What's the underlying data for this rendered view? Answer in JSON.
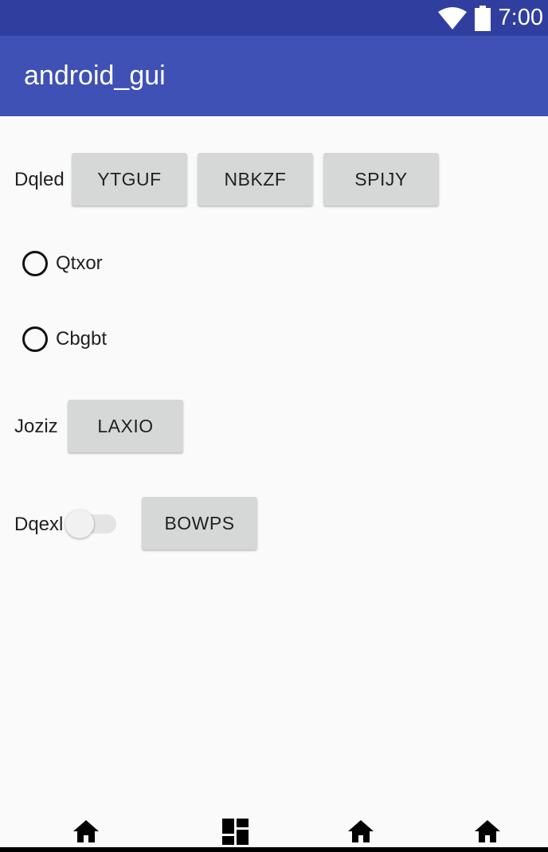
{
  "status_bar": {
    "time": "7:00",
    "icons": [
      "wifi-icon",
      "battery-icon"
    ]
  },
  "app_bar": {
    "title": "android_gui"
  },
  "rows": {
    "row1": {
      "label": "Dqled",
      "buttons": [
        "YTGUF",
        "NBKZF",
        "SPIJY"
      ]
    },
    "radios": [
      {
        "label": "Qtxor",
        "checked": false
      },
      {
        "label": "Cbgbt",
        "checked": false
      }
    ],
    "row2": {
      "label": "Joziz",
      "button": "LAXIO"
    },
    "row3": {
      "label": "Dqexl",
      "switch_on": false,
      "button": "BOWPS"
    }
  },
  "nav_bar": {
    "icons": [
      "home-icon",
      "dashboard-icon",
      "home-icon",
      "home-icon"
    ]
  },
  "colors": {
    "status": "#303f9f",
    "primary": "#3f51b5",
    "background": "#fafafa",
    "button": "#d6d7d7"
  }
}
